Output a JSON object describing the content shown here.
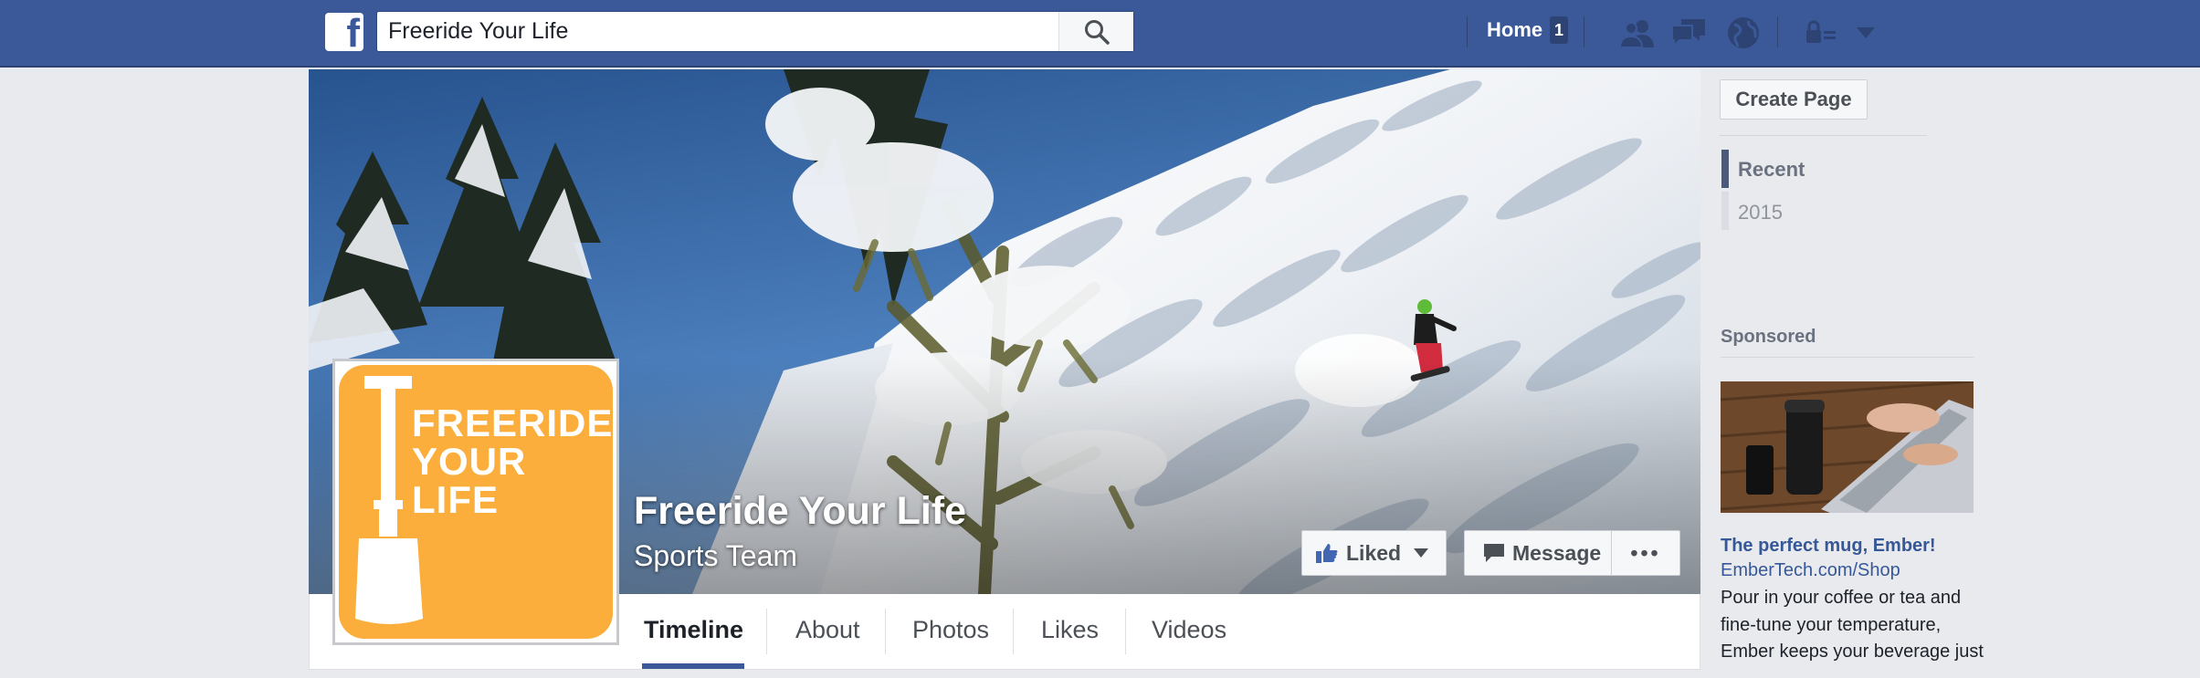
{
  "colors": {
    "fb_blue": "#3b5998",
    "logo_orange": "#fbae3c",
    "link_blue": "#365899"
  },
  "topbar": {
    "logo_letter": "f",
    "search_value": "Freeride Your Life",
    "search_icon": "magnifier-icon",
    "home_label": "Home",
    "home_count": "1",
    "icons": [
      "friend-requests-icon",
      "messages-icon",
      "notifications-globe-icon",
      "privacy-lock-icon",
      "account-menu-caret-icon"
    ]
  },
  "cover": {
    "page_name": "Freeride Your Life",
    "category": "Sports Team",
    "liked_label": "Liked",
    "message_label": "Message",
    "more_label": "•••"
  },
  "profile_logo": {
    "line1": "FREERIDE",
    "line2": "YOUR",
    "line3": "LIFE"
  },
  "tabs": [
    {
      "label": "Timeline",
      "active": true
    },
    {
      "label": "About"
    },
    {
      "label": "Photos"
    },
    {
      "label": "Likes"
    },
    {
      "label": "Videos"
    }
  ],
  "right_column": {
    "create_page_label": "Create Page",
    "timeline_nav": [
      {
        "label": "Recent",
        "active": true
      },
      {
        "label": "2015"
      }
    ],
    "sponsored_label": "Sponsored",
    "ad": {
      "title": "The perfect mug, Ember!",
      "url": "EmberTech.com/Shop",
      "body": "Pour in your coffee or tea and fine-tune your temperature, Ember keeps your beverage just"
    }
  }
}
